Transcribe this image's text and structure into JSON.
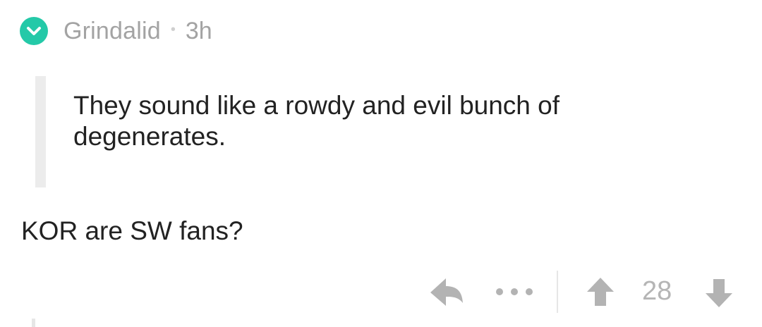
{
  "comment": {
    "author": "Grindalid",
    "separator": "•",
    "age": "3h",
    "badge_icon": "checkmark-chevron-icon",
    "badge_color": "#24c9a8",
    "quote": "They sound like a rowdy and evil bunch of degenerates.",
    "body": "KOR are SW fans?"
  },
  "actions": {
    "reply_icon": "reply-arrow-icon",
    "more_icon": "ellipsis-icon",
    "upvote_icon": "arrow-up-icon",
    "downvote_icon": "arrow-down-icon",
    "score": "28"
  },
  "colors": {
    "text": "#222222",
    "muted": "#a3a3a3",
    "icon": "#b3b3b3",
    "quote_bar": "#ececec"
  }
}
